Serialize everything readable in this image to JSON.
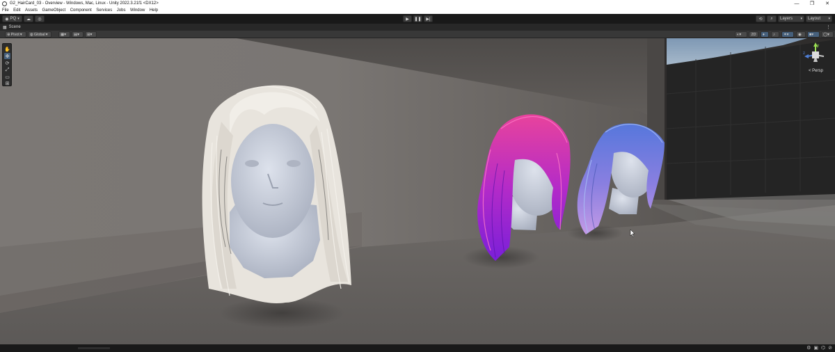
{
  "window": {
    "title": "G2_HairCard_03 - Overview - Windows, Mac, Linux - Unity 2022.3.21f1 <DX12>",
    "controls": [
      "—",
      "❐",
      "✕"
    ]
  },
  "menu": [
    "File",
    "Edit",
    "Assets",
    "GameObject",
    "Component",
    "Services",
    "Jobs",
    "Window",
    "Help"
  ],
  "toolbar": {
    "account_label": "PQ",
    "layers_label": "Layers",
    "layout_label": "Layout"
  },
  "scene_tab": {
    "label": "Scene"
  },
  "scene_toolbar": {
    "pivot_label": "Pivot",
    "global_label": "Global",
    "mode_2d_label": "2D"
  },
  "viewport": {
    "camera_label": "< Persp",
    "gizmo_axes": {
      "y": "y",
      "z": "z"
    }
  },
  "colors": {
    "hair_pink_a": "#e43c9a",
    "hair_pink_b": "#8a21d6",
    "hair_blue_a": "#5f7ad8",
    "hair_blue_b": "#b58ae3",
    "hair_white": "#e9e6e0",
    "skin": "#c9ced9"
  }
}
